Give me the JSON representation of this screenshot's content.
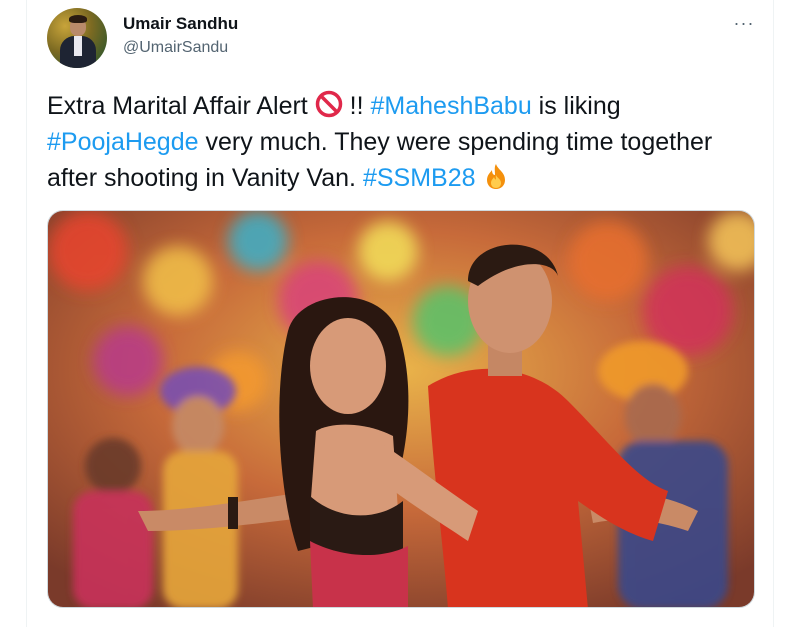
{
  "user": {
    "name": "Umair Sandhu",
    "handle": "@UmairSandu"
  },
  "tweet": {
    "text_1": "Extra Marital Affair Alert",
    "text_2": " !! ",
    "hashtag_1": "#MaheshBabu",
    "text_3": " is liking ",
    "hashtag_2": "#PoojaHegde",
    "text_4": " very much. They were spending time together after shooting in Vanity Van. ",
    "hashtag_3": "#SSMB28",
    "emoji_1": "prohibited-icon",
    "emoji_2": "fire-icon"
  },
  "menu": {
    "more_label": "···"
  },
  "colors": {
    "link": "#1d9bf0",
    "text": "#0f1419",
    "secondary": "#536471"
  }
}
